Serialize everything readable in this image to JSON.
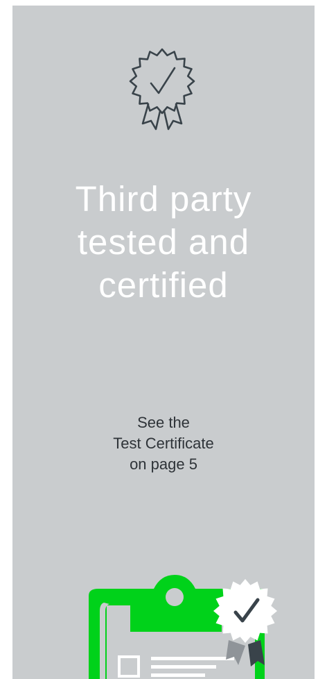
{
  "headline": {
    "line1": "Third party",
    "line2": "tested and",
    "line3": "certified"
  },
  "subtext": {
    "line1": "See the",
    "line2": "Test Certificate",
    "line3": "on page 5"
  },
  "colors": {
    "panel_background": "#c9ccce",
    "headline": "#ffffff",
    "subtext": "#2e3338",
    "icon_stroke": "#39434a",
    "accent_green": "#00d21a",
    "seal_white": "#ffffff",
    "ribbon_dark": "#39434a",
    "ribbon_light": "#8f9499"
  },
  "icons": {
    "top": "award-rosette-check-icon",
    "bottom": "certificate-clipboard-seal-icon"
  }
}
